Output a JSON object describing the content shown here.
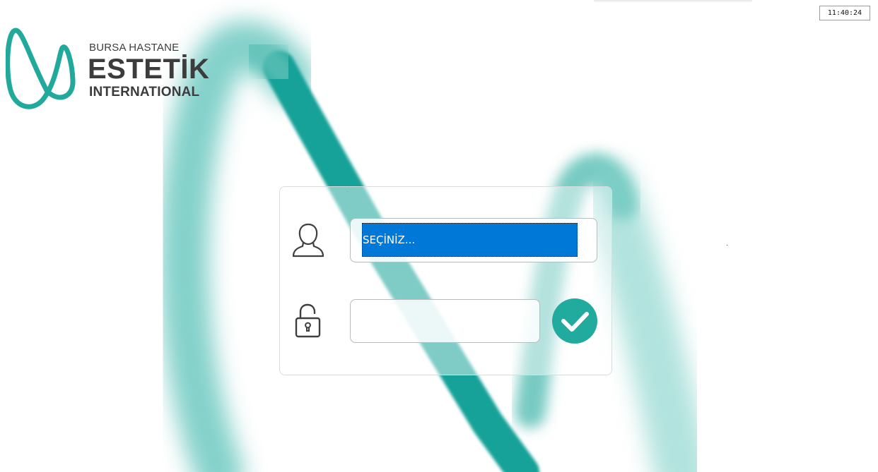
{
  "clock": {
    "time": "11:40:24"
  },
  "logo": {
    "line1": "BURSA HASTANE",
    "line2": "ESTETİK",
    "line3": "INTERNATIONAL",
    "brand_color": "#21a99c",
    "text_color": "#3c3c3c"
  },
  "login": {
    "user_select": {
      "selected": "SEÇİNİZ...",
      "highlight_color": "#0078d7"
    },
    "password": {
      "value": "",
      "placeholder": ""
    },
    "submit": {
      "icon": "checkmark-icon",
      "color": "#21ab9e"
    },
    "icons": {
      "user": "user-icon",
      "password": "unlock-icon"
    }
  },
  "background": {
    "swoosh_color": "#14a298"
  }
}
